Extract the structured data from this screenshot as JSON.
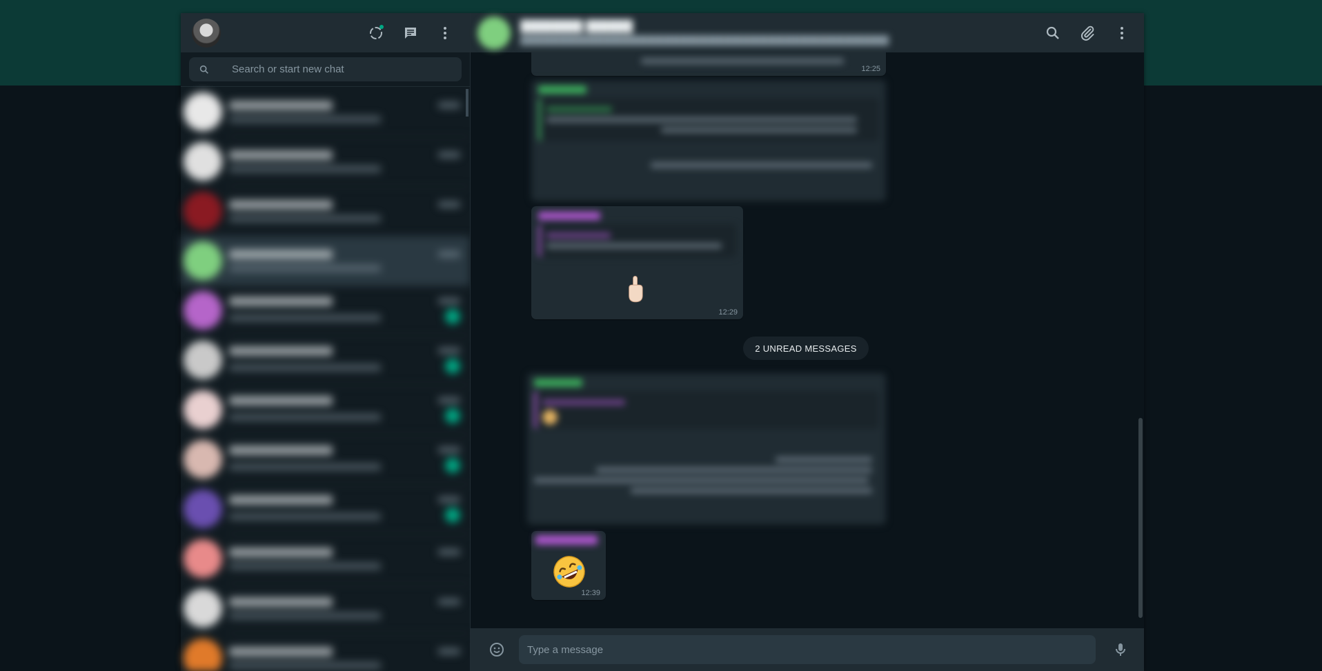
{
  "sidebar": {
    "search": {
      "placeholder": "Search or start new chat"
    },
    "chats": [
      {
        "color": "#e8e8e8",
        "badge": false,
        "active": false
      },
      {
        "color": "#e0e0e0",
        "badge": false,
        "active": false
      },
      {
        "color": "#8a1a22",
        "badge": false,
        "active": false
      },
      {
        "color": "#7fcf7f",
        "badge": false,
        "active": true
      },
      {
        "color": "#b565c9",
        "badge": true,
        "active": false
      },
      {
        "color": "#c9c9c9",
        "badge": true,
        "active": false
      },
      {
        "color": "#e9d0d0",
        "badge": true,
        "active": false
      },
      {
        "color": "#d8b8b0",
        "badge": true,
        "active": false
      },
      {
        "color": "#6a4fb0",
        "badge": true,
        "active": false
      },
      {
        "color": "#e88a8a",
        "badge": false,
        "active": false
      },
      {
        "color": "#d9d9d9",
        "badge": false,
        "active": false
      },
      {
        "color": "#e07a2a",
        "badge": false,
        "active": false
      }
    ]
  },
  "conversation": {
    "messages": [
      {
        "time": "12:25"
      },
      {
        "time": "12:29"
      },
      {
        "time": "12:39"
      }
    ],
    "unread_divider": "2 UNREAD MESSAGES",
    "composer": {
      "placeholder": "Type a message"
    }
  },
  "colors": {
    "accent": "#00a884",
    "panel": "#202c33",
    "background": "#0b141a",
    "top_band": "#0c3a36"
  }
}
